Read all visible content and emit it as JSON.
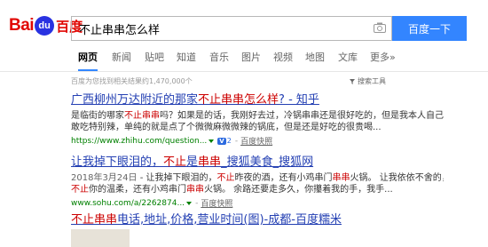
{
  "logo": {
    "part1": "Bai",
    "paw": "du",
    "part2": "百度"
  },
  "search": {
    "query": "不止串串怎么样",
    "button": "百度一下"
  },
  "tabs": [
    "网页",
    "新闻",
    "贴吧",
    "知道",
    "音乐",
    "图片",
    "视频",
    "地图",
    "文库",
    "更多»"
  ],
  "stats": "百度为您找到相关结果约1,470,000个",
  "tools": "搜索工具",
  "results": [
    {
      "title_pre": "广西柳州万达附近的那家",
      "title_hl": "不止串串怎么样",
      "title_post": "? - 知乎",
      "abs1_pre": "是临街的哪家",
      "abs1_hl": "不止串串",
      "abs1_post": "吗？如果是的话，我刚好去过，冷锅串串还是很好吃的，但是我本人自己不",
      "abs2": "敢吃特别辣，单纯的就是点了个微微麻微微辣的锅底，但是还是好吃的很贵喝...",
      "url": "https://www.zhihu.com/question...",
      "vnum": "2",
      "snapshot": "百度快照"
    },
    {
      "title_pre": "让我掉下眼泪的，",
      "title_hl": "不止",
      "title_mid": "是",
      "title_hl2": "串串",
      "title_post": "_搜狐美食_搜狐网",
      "abs1_date": "2018年3月24日",
      "abs1_pre": " - 让我掉下眼泪的，",
      "abs1_hl": "不止",
      "abs1_mid": "昨夜的酒，还有小鸡串门",
      "abs1_hl2": "串串",
      "abs1_post": "火锅。 让我依依不舍的，",
      "abs2_hl": "不止",
      "abs2_mid": "你的温柔，还有小鸡串门",
      "abs2_hl2": "串串",
      "abs2_post": "火锅。 余路还要走多久，你攥着我的手，我手...",
      "url": "www.sohu.com/a/2262874...",
      "snapshot": "百度快照"
    },
    {
      "title_hl": "不止串串",
      "title_post": "电话,地址,价格,营业时间(图)-成都-百度糯米"
    }
  ],
  "colors": {
    "accent": "#3385ff",
    "link": "#2440b3",
    "highlight": "#c00",
    "url": "#008000"
  }
}
